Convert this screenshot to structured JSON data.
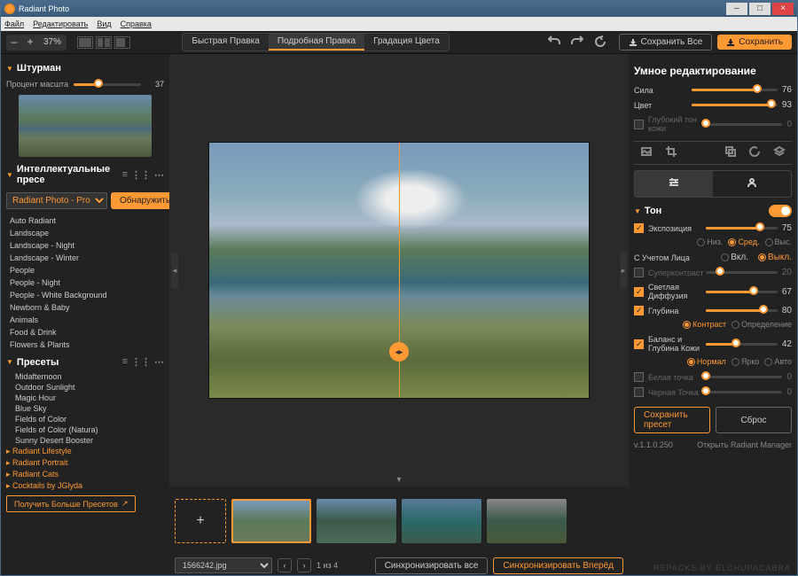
{
  "titlebar": {
    "app_name": "Radiant Photo"
  },
  "menu": {
    "file": "Файл",
    "edit": "Редактировать",
    "view": "Вид",
    "help": "Справка"
  },
  "toolbar": {
    "zoom_minus": "–",
    "zoom_plus": "+",
    "zoom_value": "37%",
    "tab_quick": "Быстрая Правка",
    "tab_detail": "Подробная Правка",
    "tab_grade": "Градация Цвета",
    "save_all": "Сохранить Все",
    "save": "Сохранить"
  },
  "navigator": {
    "title": "Штурман",
    "scale_label": "Процент масштабир",
    "scale_value": 37
  },
  "presets_smart": {
    "title": "Интеллектуальные пресе",
    "select": "Radiant Photo - Pro",
    "detect": "Обнаружить",
    "items": [
      "Auto Radiant",
      "Landscape",
      "Landscape - Night",
      "Landscape - Winter",
      "People",
      "People - Night",
      "People - White Background",
      "Newborn & Baby",
      "Animals",
      "Food & Drink",
      "Flowers & Plants"
    ]
  },
  "presets": {
    "title": "Пресеты",
    "items": [
      "Midafternoon",
      "Outdoor Sunlight",
      "Magic Hour",
      "Blue Sky",
      "Fields of Color",
      "Fields of Color (Natura)",
      "Sunny Desert Booster"
    ],
    "cats": [
      "Radiant Lifestyle",
      "Radiant Portrait",
      "Radiant Cats",
      "Cocktails by JGlyda"
    ],
    "get_more": "Получить Больше Пресетов"
  },
  "filmstrip": {
    "file": "1566242.jpg",
    "pos": "1 из 4",
    "sync_all": "Синхронизировать все",
    "sync_fwd": "Синхронизировать Вперёд"
  },
  "right": {
    "smart_title": "Умное редактирование",
    "strength": {
      "label": "Сила",
      "value": 76
    },
    "color": {
      "label": "Цвет",
      "value": 93
    },
    "skin": {
      "label": "Глубокий тон кожи",
      "value": 0
    },
    "tone": {
      "title": "Тон"
    },
    "exposure": {
      "label": "Экспозиция",
      "value": 75,
      "opts": [
        "Низ.",
        "Сред.",
        "Выс."
      ],
      "sel": "Сред."
    },
    "face": {
      "label": "С Учетом Лица",
      "opts": [
        "Вкл.",
        "Выкл."
      ],
      "sel": "Выкл."
    },
    "supercontrast": {
      "label": "Суперконтраст",
      "value": 20
    },
    "diffusion": {
      "label": "Светлая Диффузия",
      "value": 67
    },
    "depth": {
      "label": "Глубина",
      "value": 80,
      "opts": [
        "Контраст",
        "Определение"
      ],
      "sel": "Контраст"
    },
    "skin_balance": {
      "label": "Баланс и Глубина Кожи",
      "value": 42,
      "opts": [
        "Нормал",
        "Ярко",
        "Авто"
      ],
      "sel": "Нормал"
    },
    "white": {
      "label": "Белая точка",
      "value": 0
    },
    "black": {
      "label": "Черная Точка",
      "value": 0
    },
    "save_preset": "Сохранить пресет",
    "reset": "Сброс",
    "version": "v.1.1.0.250",
    "open_mgr": "Открыть Radiant Manager"
  },
  "watermark": "REPACKS BY ELCHUPACABRA"
}
